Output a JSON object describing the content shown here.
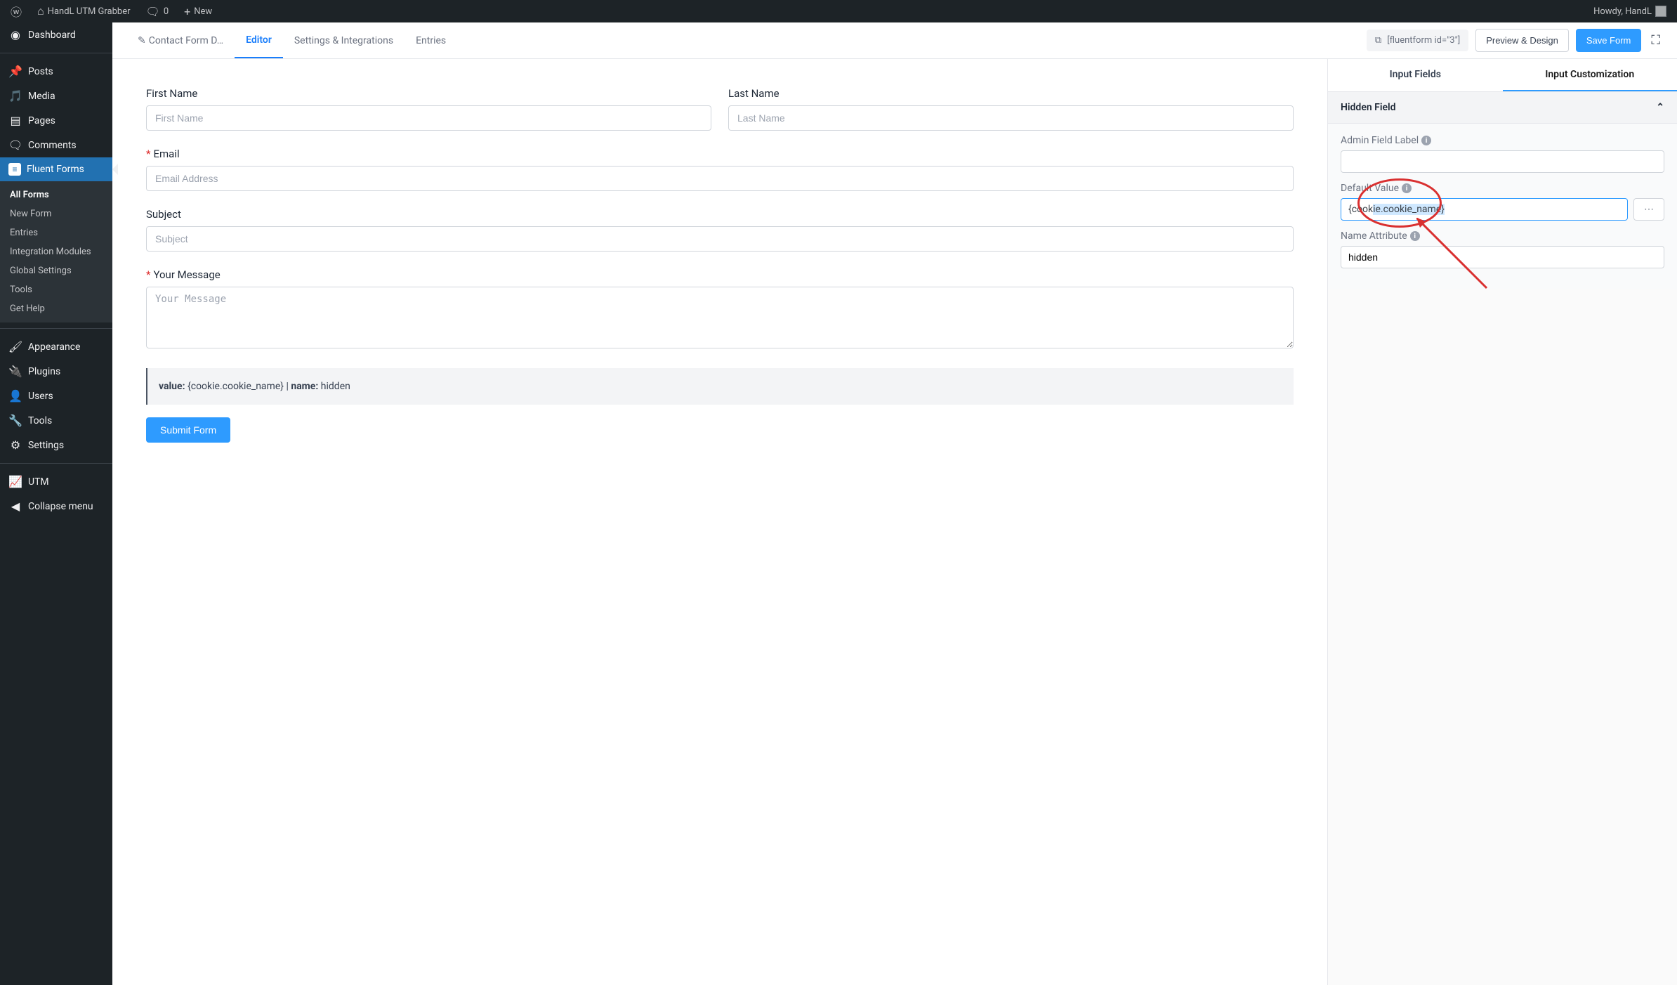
{
  "adminbar": {
    "site_title": "HandL UTM Grabber",
    "comments_count": "0",
    "new_label": "New",
    "howdy": "Howdy, HandL"
  },
  "sidebar": {
    "dashboard": "Dashboard",
    "posts": "Posts",
    "media": "Media",
    "pages": "Pages",
    "comments": "Comments",
    "fluent_forms": "Fluent Forms",
    "ff_submenu": {
      "all_forms": "All Forms",
      "new_form": "New Form",
      "entries": "Entries",
      "integration_modules": "Integration Modules",
      "global_settings": "Global Settings",
      "tools": "Tools",
      "get_help": "Get Help"
    },
    "appearance": "Appearance",
    "plugins": "Plugins",
    "users": "Users",
    "tools": "Tools",
    "settings": "Settings",
    "utm": "UTM",
    "collapse": "Collapse menu"
  },
  "topbar": {
    "breadcrumb": "Contact Form D…",
    "tab_editor": "Editor",
    "tab_settings": "Settings & Integrations",
    "tab_entries": "Entries",
    "shortcode": "[fluentform id=\"3\"]",
    "preview_design": "Preview & Design",
    "save_form": "Save Form"
  },
  "form": {
    "first_name_label": "First Name",
    "first_name_placeholder": "First Name",
    "last_name_label": "Last Name",
    "last_name_placeholder": "Last Name",
    "email_label": "Email",
    "email_placeholder": "Email Address",
    "subject_label": "Subject",
    "subject_placeholder": "Subject",
    "message_label": "Your Message",
    "message_placeholder": "Your Message",
    "hidden_box_value_label": "value:",
    "hidden_box_value": " {cookie.cookie_name} | ",
    "hidden_box_name_label": "name:",
    "hidden_box_name": " hidden",
    "submit_label": "Submit Form"
  },
  "panel": {
    "tab_input_fields": "Input Fields",
    "tab_customization": "Input Customization",
    "section_header": "Hidden Field",
    "admin_label": "Admin Field Label",
    "default_value_label": "Default Value",
    "default_value": "{cookie.cookie_name}",
    "name_attr_label": "Name Attribute",
    "name_attr_value": "hidden"
  }
}
